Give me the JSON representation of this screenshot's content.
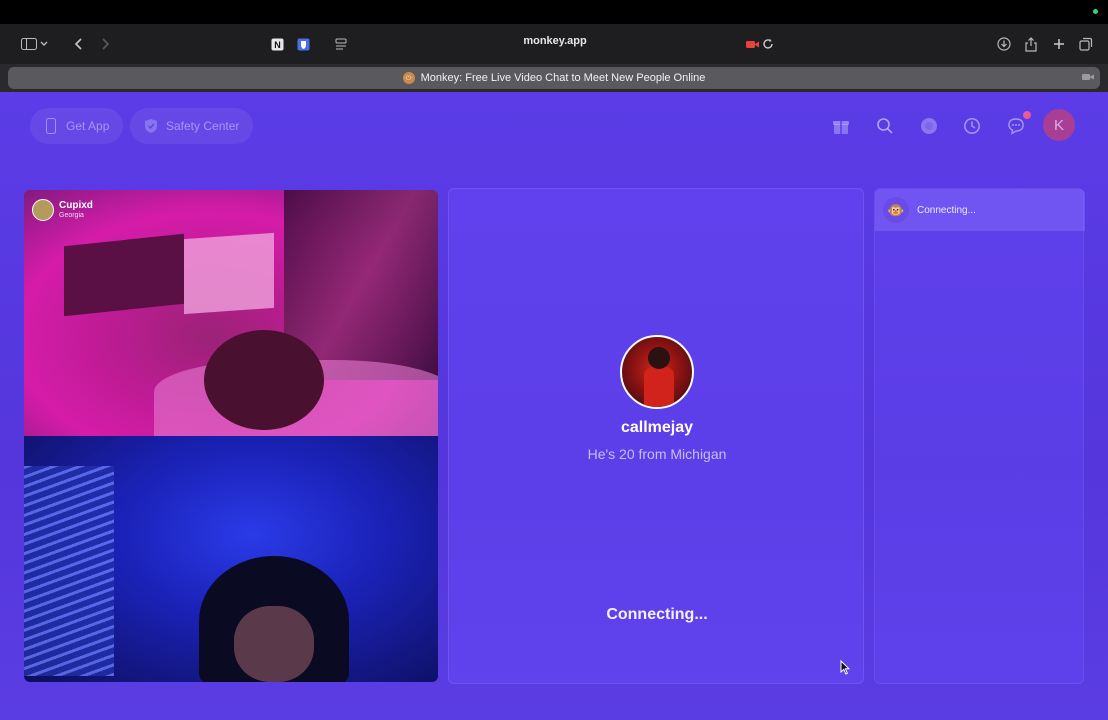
{
  "browser": {
    "url": "monkey.app",
    "tab_title": "Monkey: Free Live Video Chat to Meet New People Online",
    "tab_favicon": "🐵"
  },
  "header": {
    "get_app_label": "Get App",
    "safety_center_label": "Safety Center",
    "profile_initial": "K"
  },
  "local_video": {
    "peer_name": "Cupixd",
    "peer_location": "Georgia"
  },
  "match": {
    "username": "callmejay",
    "subtitle": "He's 20 from Michigan",
    "status": "Connecting..."
  },
  "chat": {
    "status": "Connecting...",
    "avatar_emoji": "🐵"
  },
  "colors": {
    "page_bg": "#5a3be0",
    "panel_bg": "#6e50ff",
    "badge": "#e85a9a",
    "profile": "#c4407b"
  }
}
